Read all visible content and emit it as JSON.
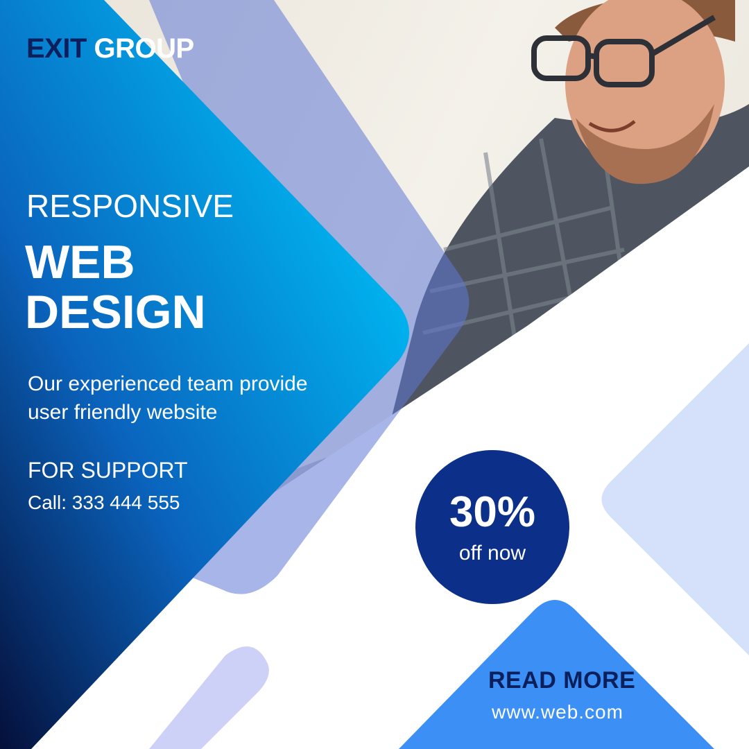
{
  "brand": {
    "part1": "EXIT",
    "part2": "GROUP"
  },
  "headline": {
    "sub": "RESPONSIVE",
    "main_line1": "WEB",
    "main_line2": "DESIGN"
  },
  "description": {
    "line1": "Our experienced team provide",
    "line2": "user friendly website"
  },
  "support": {
    "label": "FOR SUPPORT",
    "phone": "Call: 333 444 555"
  },
  "offer": {
    "value": "30%",
    "caption": "off now"
  },
  "cta": {
    "label": "READ MORE",
    "url": "www.web.com"
  },
  "colors": {
    "navy": "#0a1f5c",
    "cyan": "#00b0ee",
    "badge": "#0c2f8a",
    "accent_blue": "#3b8ff5",
    "lavender": "#d5e0fb"
  }
}
